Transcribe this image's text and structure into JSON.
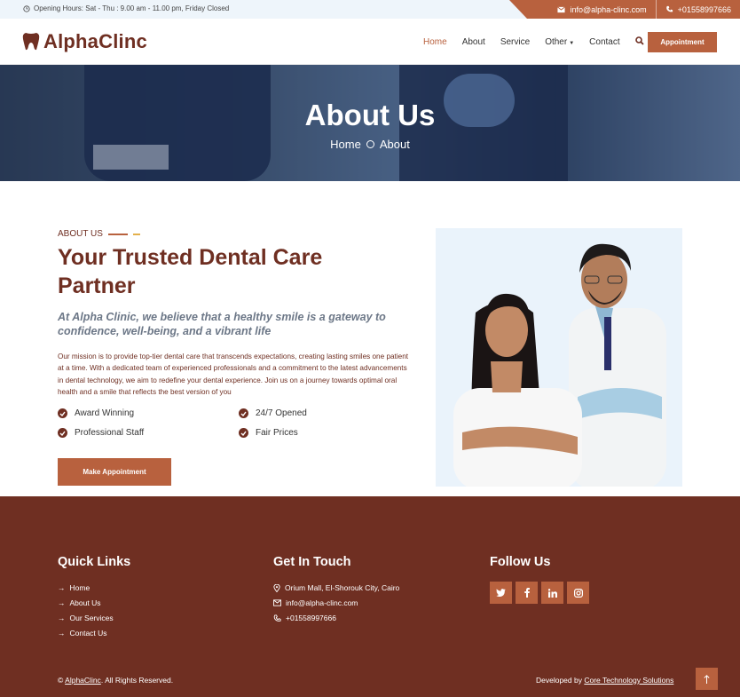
{
  "topbar": {
    "hours": "Opening Hours: Sat - Thu : 9.00 am - 11.00 pm, Friday Closed",
    "email": "info@alpha-clinc.com",
    "phone": "+01558997666"
  },
  "brand": {
    "name": "AlphaClinc"
  },
  "nav": {
    "items": [
      "Home",
      "About",
      "Service",
      "Other",
      "Contact"
    ],
    "active": "Home",
    "appointment": "Appointment"
  },
  "hero": {
    "title": "About Us",
    "crumb_home": "Home",
    "crumb_current": "About"
  },
  "about": {
    "eyebrow": "ABOUT US",
    "heading": "Your Trusted Dental Care Partner",
    "lead": "At Alpha Clinic, we believe that a healthy smile is a gateway to confidence, well-being, and a vibrant life",
    "body": "Our mission is to provide top-tier dental care that transcends expectations, creating lasting smiles one patient at a time. With a dedicated team of experienced professionals and a commitment to the latest advancements in dental technology, we aim to redefine your dental experience. Join us on a journey towards optimal oral health and a smile that reflects the best version of you",
    "features": [
      "Award Winning",
      "24/7 Opened",
      "Professional Staff",
      "Fair Prices"
    ],
    "cta": "Make Appointment"
  },
  "footer": {
    "quick_title": "Quick Links",
    "quick_links": [
      "Home",
      "About Us",
      "Our Services",
      "Contact Us"
    ],
    "touch_title": "Get In Touch",
    "address": "Orium Mall, El-Shorouk City, Cairo",
    "email": "info@alpha-clinc.com",
    "phone": "+01558997666",
    "follow_title": "Follow Us",
    "social_icons": [
      "twitter-icon",
      "facebook-icon",
      "linkedin-icon",
      "instagram-icon"
    ],
    "copy_prefix": "©",
    "copy_brand": "AlphaClinc",
    "copy_suffix": ". All Rights Reserved.",
    "dev_prefix": "Developed by",
    "dev_company": "Core Technology Solutions"
  },
  "colors": {
    "brand_dark": "#6f2f22",
    "accent": "#b8613e",
    "topbar_bg": "#eef5fb"
  }
}
